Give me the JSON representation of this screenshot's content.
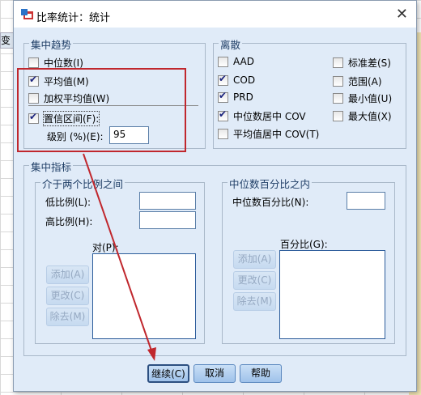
{
  "background": {
    "column_header": "变量"
  },
  "dialog": {
    "title": "比率统计：统计",
    "close_label": "✕"
  },
  "central": {
    "title": "集中趋势",
    "items": [
      {
        "label": "中位数(I)",
        "checked": false
      },
      {
        "label": "平均值(M)",
        "checked": true
      },
      {
        "label": "加权平均值(W)",
        "checked": false
      },
      {
        "label": "置信区间(F):",
        "checked": true
      }
    ],
    "level_label": "级别 (%)(E):",
    "level_value": "95"
  },
  "dispersion": {
    "title": "离散",
    "items": [
      {
        "label": "AAD",
        "checked": false
      },
      {
        "label": "COD",
        "checked": true
      },
      {
        "label": "PRD",
        "checked": true
      },
      {
        "label": "中位数居中 COV",
        "checked": true
      },
      {
        "label": "平均值居中 COV(T)",
        "checked": false
      },
      {
        "label": "标准差(S)",
        "checked": false
      },
      {
        "label": "范围(A)",
        "checked": false
      },
      {
        "label": "最小值(U)",
        "checked": false
      },
      {
        "label": "最大值(X)",
        "checked": false
      }
    ]
  },
  "concentration": {
    "title": "集中指标",
    "between": {
      "title": "介于两个比例之间",
      "low_label": "低比例(L):",
      "low_value": "",
      "high_label": "高比例(H):",
      "high_value": "",
      "pairs_label": "对(P):",
      "add": "添加(A)",
      "change": "更改(C)",
      "remove": "除去(M)"
    },
    "within": {
      "title": "中位数百分比之内",
      "median_label": "中位数百分比(N):",
      "median_value": "",
      "percent_label": "百分比(G):",
      "add": "添加(A)",
      "change": "更改(C)",
      "remove": "除去(M)"
    }
  },
  "footer": {
    "continue": "继续(C)",
    "cancel": "取消",
    "help": "帮助"
  },
  "annotation_color": "#c0272d"
}
